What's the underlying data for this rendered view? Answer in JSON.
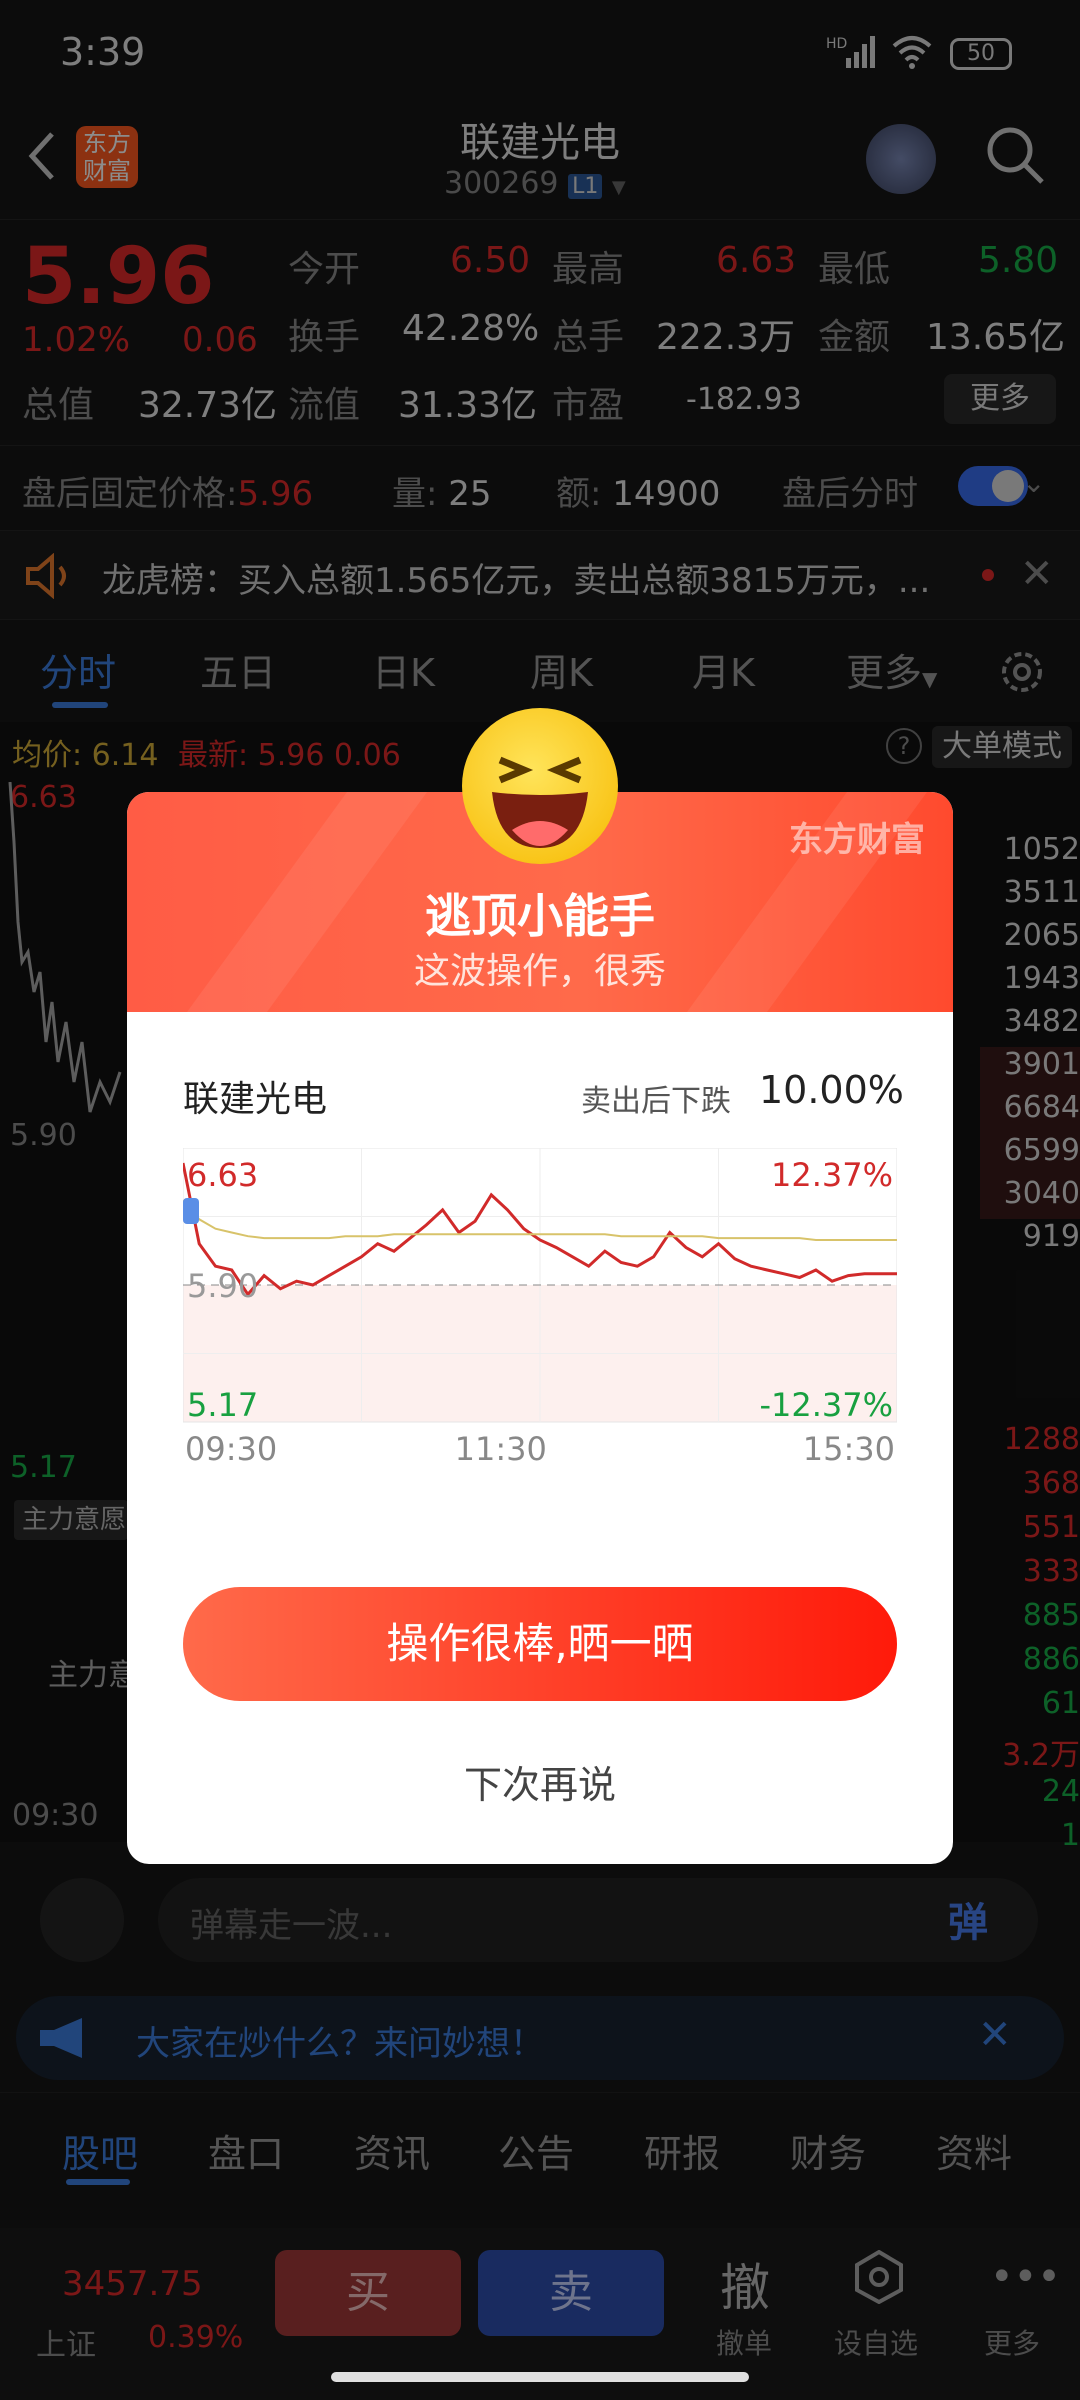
{
  "status_bar": {
    "time": "3:39",
    "battery": "50"
  },
  "header": {
    "title": "联建光电",
    "code": "300269",
    "level": "L1",
    "logo_text": "东方\n财富"
  },
  "quote": {
    "price": "5.96",
    "change_pct": "1.02%",
    "change": "0.06",
    "fields": [
      {
        "label": "今开",
        "value": "6.50"
      },
      {
        "label": "最高",
        "value": "6.63"
      },
      {
        "label": "最低",
        "value": "5.80"
      },
      {
        "label": "换手",
        "value": "42.28%"
      },
      {
        "label": "总手",
        "value": "222.3万"
      },
      {
        "label": "金额",
        "value": "13.65亿"
      },
      {
        "label": "总值",
        "value": "32.73亿"
      },
      {
        "label": "流值",
        "value": "31.33亿"
      },
      {
        "label": "市盈",
        "value": "-182.93"
      }
    ],
    "more": "更多"
  },
  "after_hours": {
    "label": "盘后固定价格:",
    "price": "5.96",
    "vol_label": "量:",
    "vol": "25",
    "amt_label": "额:",
    "amt": "14900",
    "toggle_label": "盘后分时"
  },
  "dragon": {
    "text": "龙虎榜：买入总额1.565亿元，卖出总额3815万元，..."
  },
  "tabs": [
    "分时",
    "五日",
    "日K",
    "周K",
    "月K",
    "更多"
  ],
  "chart_info": {
    "avg_label": "均价:",
    "avg": "6.14",
    "latest_label": "最新:",
    "latest": "5.96",
    "latest_chg": "0.06",
    "mode": "大单模式",
    "high": "6.63",
    "mid": "5.90",
    "low": "5.17",
    "time_start": "09:30",
    "main_label": "主力意愿",
    "main_panel": "主力意"
  },
  "modal": {
    "title": "逃顶小能手",
    "subtitle": "这波操作，很秀",
    "brand": "东方财富",
    "stock": "联建光电",
    "drop_label": "卖出后下跌",
    "drop_value": "10.00%",
    "cta": "操作很棒,晒一晒",
    "later": "下次再说"
  },
  "chart_data": {
    "type": "line",
    "ylim": [
      5.17,
      6.63
    ],
    "y_labels_left": [
      "6.63",
      "5.90",
      "5.17"
    ],
    "y_labels_right": [
      "12.37%",
      "-12.37%"
    ],
    "x_labels": [
      "09:30",
      "11:30",
      "15:30"
    ],
    "series": [
      {
        "values": [
          6.55,
          6.12,
          6.0,
          5.98,
          5.85,
          5.95,
          5.88,
          5.92,
          5.9,
          5.95,
          6.0,
          6.05,
          6.12,
          6.08,
          6.15,
          6.22,
          6.3,
          6.18,
          6.24,
          6.38,
          6.3,
          6.2,
          6.14,
          6.1,
          6.05,
          6.0,
          6.08,
          6.02,
          6.0,
          6.05,
          6.18,
          6.1,
          6.05,
          6.12,
          6.04,
          6.0,
          5.98,
          5.96,
          5.94,
          5.98,
          5.92,
          5.95,
          5.96,
          5.96,
          5.96
        ]
      },
      {
        "values": [
          6.35,
          6.25,
          6.2,
          6.18,
          6.16,
          6.15,
          6.15,
          6.15,
          6.15,
          6.15,
          6.16,
          6.16,
          6.16,
          6.17,
          6.17,
          6.17,
          6.17,
          6.17,
          6.17,
          6.17,
          6.17,
          6.17,
          6.17,
          6.17,
          6.17,
          6.17,
          6.17,
          6.16,
          6.16,
          6.16,
          6.16,
          6.16,
          6.16,
          6.15,
          6.15,
          6.15,
          6.15,
          6.15,
          6.15,
          6.14,
          6.14,
          6.14,
          6.14,
          6.14,
          6.14
        ]
      }
    ]
  },
  "order_book_right": [
    "1052",
    "3511",
    "2065",
    "1943",
    "3482",
    "3901",
    "6684",
    "6599",
    "3040",
    "919"
  ],
  "trades_right": [
    "1288",
    "368",
    "551",
    "333",
    "885",
    "886",
    "61",
    "3.2万",
    "24",
    "1"
  ],
  "comment_placeholder": "弹幕走一波...",
  "comment_btn": "弹",
  "banner_text": "大家在炒什么？来问妙想！",
  "bottom_tabs": [
    "股吧",
    "盘口",
    "资讯",
    "公告",
    "研报",
    "财务",
    "资料"
  ],
  "toolbar": {
    "index_value": "3457.75",
    "index_name": "上证",
    "index_pct": "0.39%",
    "buy": "买",
    "sell": "卖",
    "cancel_icon": "撤",
    "cancel": "撤单",
    "watch": "设自选",
    "more": "更多"
  }
}
